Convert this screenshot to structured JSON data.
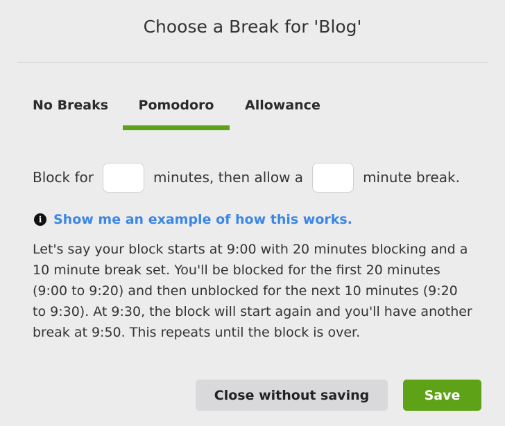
{
  "dialog": {
    "title": "Choose a Break for 'Blog'"
  },
  "tabs": [
    {
      "label": "No Breaks",
      "selected": false
    },
    {
      "label": "Pomodoro",
      "selected": true
    },
    {
      "label": "Allowance",
      "selected": false
    }
  ],
  "block": {
    "prefix": "Block for",
    "middle": "minutes, then allow a",
    "suffix": "minute break.",
    "block_minutes_value": "",
    "break_minutes_value": ""
  },
  "example": {
    "icon": "info-icon",
    "link_text": "Show me an example of how this works.",
    "explanation": "Let's say your block starts at 9:00 with 20 minutes blocking and a 10 minute break set. You'll be blocked for the first 20 minutes (9:00 to 9:20) and then unblocked for the next 10 minutes (9:20 to 9:30). At 9:30, the block will start again and you'll have another break at 9:50. This repeats until the block is over."
  },
  "buttons": {
    "close_label": "Close without saving",
    "save_label": "Save"
  },
  "colors": {
    "accent": "#5ea317",
    "link": "#3b86e6",
    "background": "#ececec"
  }
}
